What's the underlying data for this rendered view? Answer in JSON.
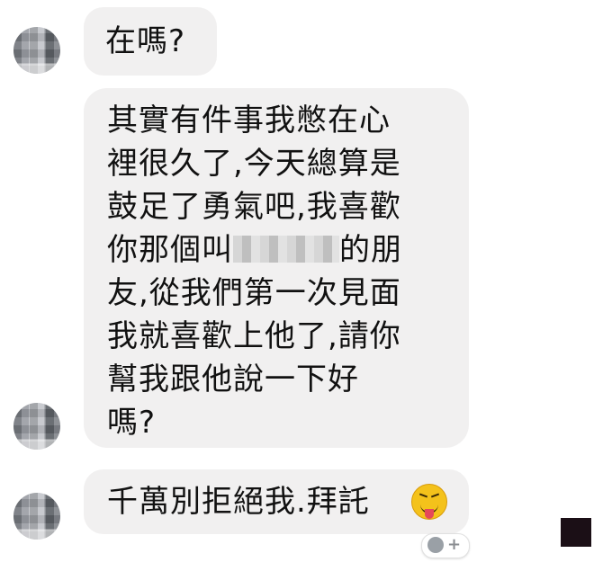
{
  "messages": [
    {
      "text": "在嗎?"
    },
    {
      "line1": "其實有件事我憋在心",
      "line2": "裡很久了,今天總算是",
      "line3": "鼓足了勇氣吧,我喜歡",
      "line4_pre": "你那個叫",
      "line4_post": "的朋",
      "line5": "友,從我們第一次見面",
      "line6": "我就喜歡上他了,請你",
      "line7": "幫我跟他說一下好",
      "line8": "嗎?"
    },
    {
      "text": "千萬別拒絕我.拜託",
      "emoji": "squinting-face-with-tongue"
    }
  ],
  "react_button": {
    "plus": "+"
  }
}
